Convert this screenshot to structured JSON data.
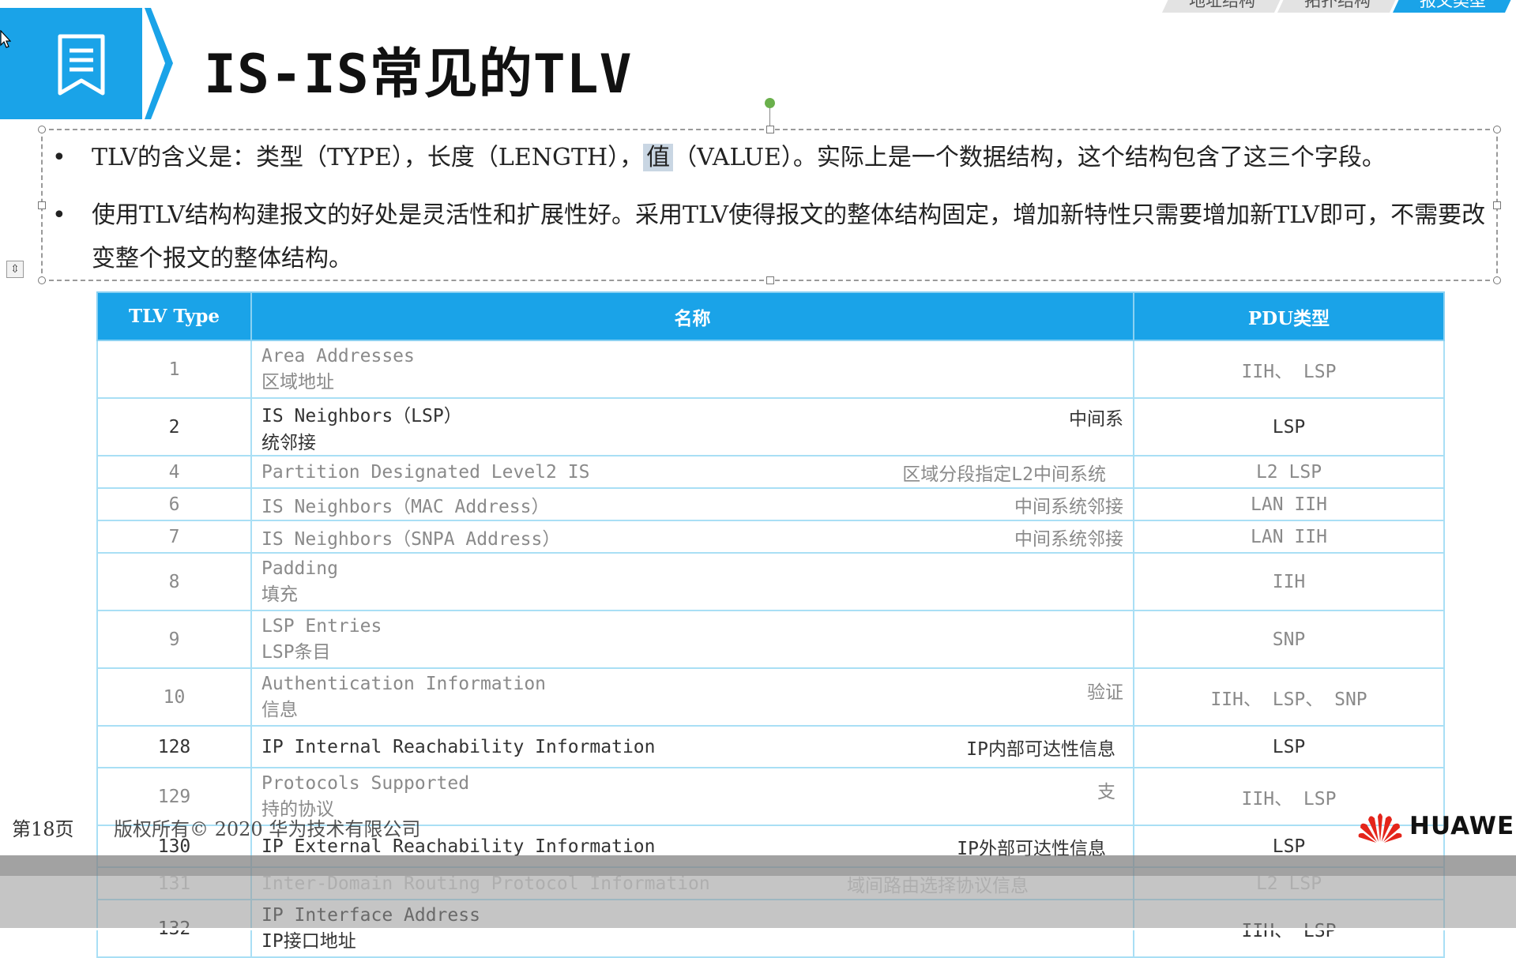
{
  "nav_tabs": [
    "地址结构",
    "拓扑结构",
    "报文类型"
  ],
  "title": "IS-IS常见的TLV",
  "bullets": {
    "b1_pre": "TLV的含义是：类型（TYPE），长度（LENGTH），",
    "b1_hl": "值",
    "b1_post": "（VALUE）。实际上是一个数据结构，这个结构包含了这三个字段。",
    "b2": "使用TLV结构构建报文的好处是灵活性和扩展性好。采用TLV使得报文的整体结构固定，增加新特性只需要增加新TLV即可，不需要改变整个报文的整体结构。"
  },
  "table": {
    "headers": [
      "TLV Type",
      "名称",
      "PDU类型"
    ],
    "rows": [
      {
        "type": "1",
        "name_en": "Area Addresses",
        "name_cn": "区域地址",
        "pdu": "IIH、 LSP"
      },
      {
        "type": "2",
        "name_en": "IS Neighbors（LSP）",
        "name_cn": "统邻接",
        "name_right": "中间系",
        "pdu": "LSP"
      },
      {
        "type": "4",
        "name_en": "Partition Designated Level2 IS",
        "name_right": "区域分段指定L2中间系统",
        "pdu": "L2 LSP"
      },
      {
        "type": "6",
        "name_en": "IS Neighbors（MAC Address）",
        "name_right": "中间系统邻接",
        "pdu": "LAN IIH"
      },
      {
        "type": "7",
        "name_en": "IS Neighbors（SNPA Address）",
        "name_right": "中间系统邻接",
        "pdu": "LAN IIH"
      },
      {
        "type": "8",
        "name_en": "Padding",
        "name_cn": "填充",
        "pdu": "IIH"
      },
      {
        "type": "9",
        "name_en": "LSP Entries",
        "name_cn": "LSP条目",
        "pdu": "SNP"
      },
      {
        "type": "10",
        "name_en": "Authentication Information",
        "name_cn": "信息",
        "name_right": "验证",
        "pdu": "IIH、 LSP、 SNP"
      },
      {
        "type": "128",
        "name_en": "IP Internal Reachability Information",
        "name_right": "IP内部可达性信息",
        "pdu": "LSP"
      },
      {
        "type": "129",
        "name_en": "Protocols Supported",
        "name_cn": "持的协议",
        "name_right": "支",
        "pdu": "IIH、 LSP"
      },
      {
        "type": "130",
        "name_en": "IP External Reachability Information",
        "name_right": "IP外部可达性信息",
        "pdu": "LSP"
      },
      {
        "type": "131",
        "name_en": "Inter-Domain Routing Protocol Information",
        "name_right": "域间路由选择协议信息",
        "pdu": "L2 LSP"
      },
      {
        "type": "132",
        "name_en": "IP Interface Address",
        "name_cn": "IP接口地址",
        "pdu": "IIH、 LSP"
      }
    ]
  },
  "footer": {
    "page": "第18页",
    "copyright": "版权所有© 2020 华为技术有限公司",
    "brand": "HUAWEI"
  },
  "colors": {
    "accent": "#1aa3e8",
    "logo_red": "#e4251b"
  }
}
